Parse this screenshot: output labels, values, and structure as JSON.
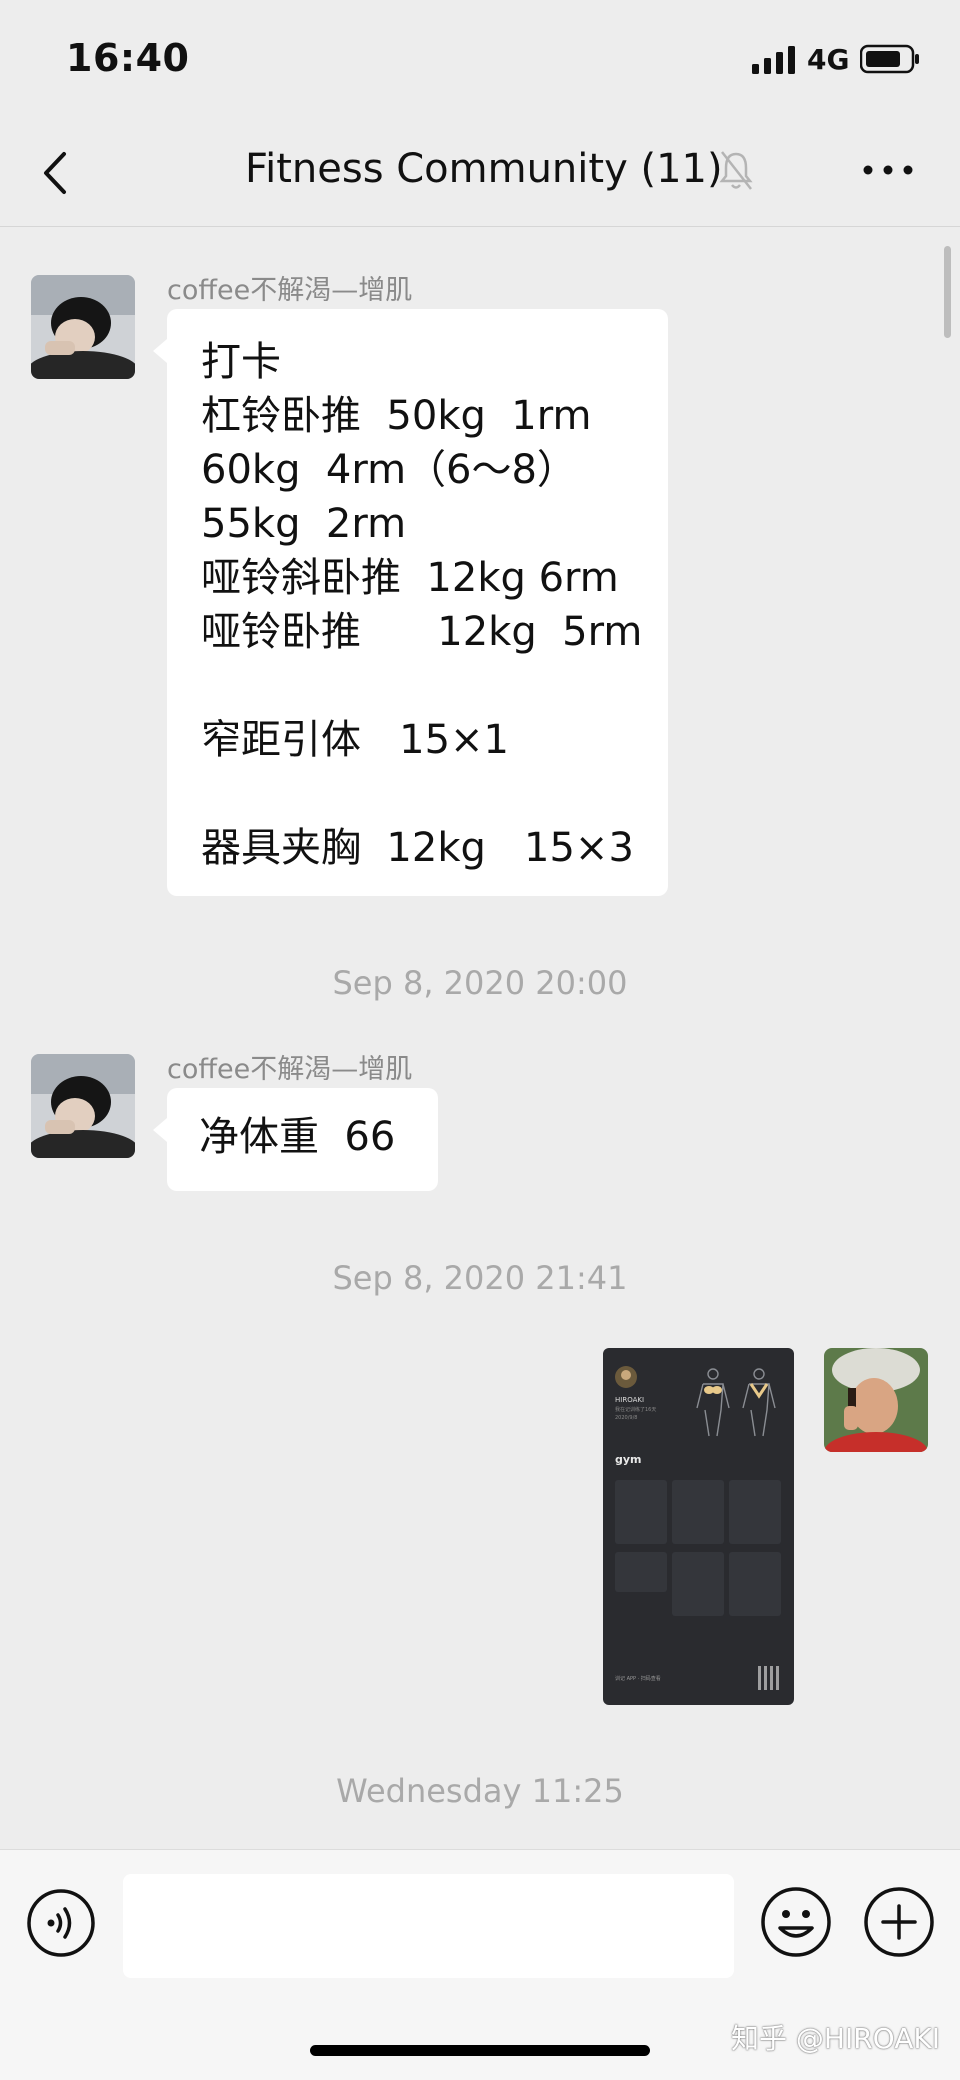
{
  "status_bar": {
    "time": "16:40",
    "network": "4G"
  },
  "header": {
    "title": "Fitness Community (11)"
  },
  "messages": [
    {
      "sender": "coffee不解渴—增肌",
      "lines": [
        "打卡",
        "杠铃卧推  50kg  1rm",
        "60kg  4rm（6～8）",
        "55kg  2rm",
        "哑铃斜卧推  12kg 6rm",
        "哑铃卧推      12kg  5rm",
        "",
        "窄距引体   15×1",
        "",
        "器具夹胸  12kg   15×3"
      ]
    },
    {
      "sender": "coffee不解渴—增肌",
      "lines": [
        "净体重  66"
      ]
    }
  ],
  "timestamps": [
    "Sep 8, 2020 20:00",
    "Sep 8, 2020 21:41",
    "Wednesday 11:25"
  ],
  "image_card": {
    "name": "HIROAKI",
    "subtitle": "我在记训练了16天\n2020/9/8",
    "title": "gym",
    "footer": "训记 APP · 扫码查看"
  },
  "input": {
    "value": "",
    "placeholder": ""
  },
  "watermark": "知乎 @HIROAKI",
  "colors": {
    "background": "#ededed",
    "bubble": "#ffffff",
    "timestamp": "#a9a9a9"
  }
}
